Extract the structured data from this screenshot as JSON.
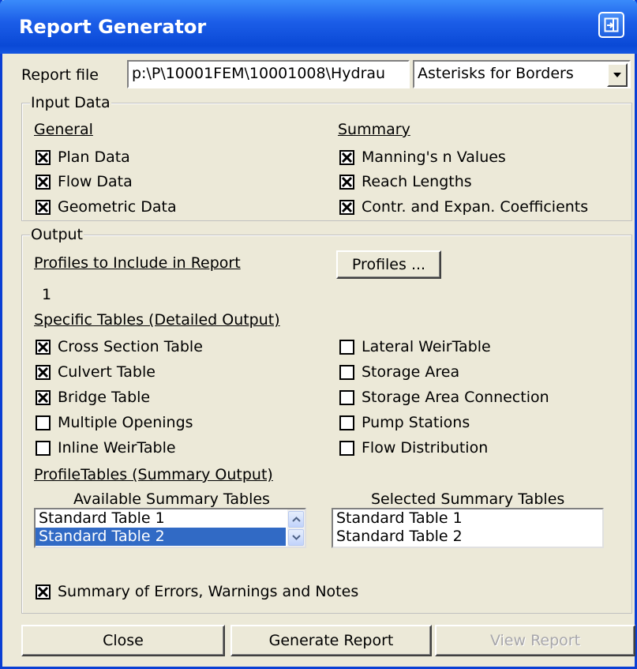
{
  "window": {
    "title": "Report Generator"
  },
  "report_file": {
    "label": "Report file",
    "path": "p:\\P\\10001FEM\\10001008\\Hydrau",
    "style_select": "Asterisks for Borders"
  },
  "input_data": {
    "title": "Input Data",
    "general": {
      "heading": "General",
      "items": [
        {
          "label": "Plan Data",
          "checked": true
        },
        {
          "label": "Flow Data",
          "checked": true
        },
        {
          "label": "Geometric Data",
          "checked": true
        }
      ]
    },
    "summary": {
      "heading": "Summary",
      "items": [
        {
          "label": "Manning's n Values",
          "checked": true
        },
        {
          "label": "Reach Lengths",
          "checked": true
        },
        {
          "label": "Contr. and Expan. Coefficients",
          "checked": true
        }
      ]
    }
  },
  "output": {
    "title": "Output",
    "profiles_heading": "Profiles to Include in Report",
    "profiles_button": "Profiles ...",
    "profiles_value": "1",
    "specific_heading": "Specific Tables (Detailed Output)",
    "specific_left": [
      {
        "label": "Cross Section Table",
        "checked": true
      },
      {
        "label": "Culvert Table",
        "checked": true
      },
      {
        "label": "Bridge Table",
        "checked": true
      },
      {
        "label": "Multiple Openings",
        "checked": false
      },
      {
        "label": "Inline WeirTable",
        "checked": false
      }
    ],
    "specific_right": [
      {
        "label": "Lateral WeirTable",
        "checked": false
      },
      {
        "label": "Storage Area",
        "checked": false
      },
      {
        "label": "Storage Area Connection",
        "checked": false
      },
      {
        "label": "Pump Stations",
        "checked": false
      },
      {
        "label": "Flow Distribution",
        "checked": false
      }
    ],
    "profile_tables_heading": "ProfileTables (Summary Output)",
    "available_heading": "Available Summary Tables",
    "available": [
      "Standard Table 1",
      "Standard Table 2"
    ],
    "available_selected": "Standard Table 2",
    "selected_heading": "Selected Summary Tables",
    "selected": [
      "Standard Table 1",
      "Standard Table 2"
    ],
    "summary_errors": {
      "label": "Summary of Errors, Warnings and Notes",
      "checked": true
    }
  },
  "buttons": {
    "close": "Close",
    "generate": "Generate Report",
    "view": "View Report"
  },
  "colors": {
    "titlebar": "#0a49d6",
    "window_bg": "#ece9d8",
    "selection": "#316ac5"
  },
  "icons": {
    "titlebar_button": "restore-window-icon",
    "combo": "chevron-down-icon",
    "scroll_up": "arrow-up-icon",
    "scroll_down": "arrow-down-icon"
  }
}
